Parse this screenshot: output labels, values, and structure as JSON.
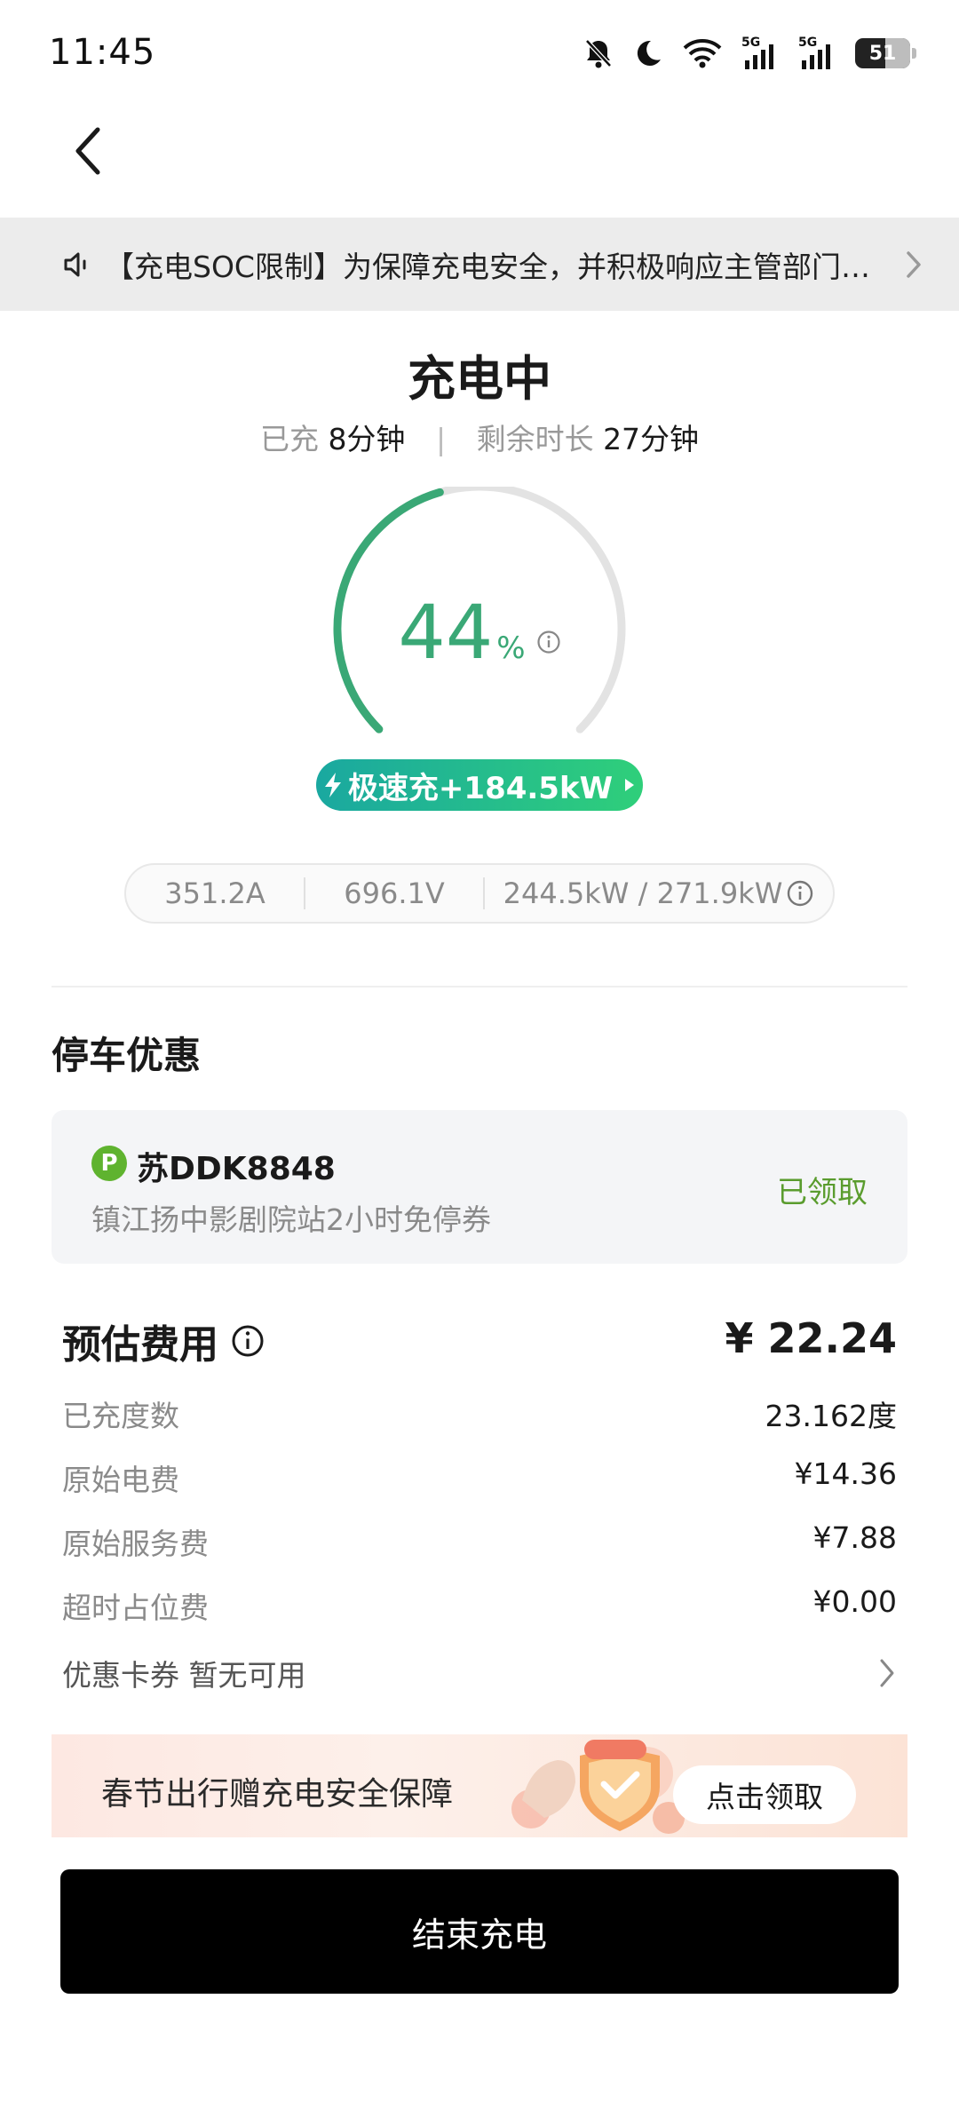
{
  "status_bar": {
    "time": "11:45",
    "network_1": "5G",
    "network_2": "5G",
    "battery_level": "51",
    "icons": [
      "bell-muted-icon",
      "moon-icon",
      "wifi-icon",
      "signal-5g-icon",
      "signal-5g-icon",
      "battery-icon"
    ]
  },
  "header": {
    "back_icon": "chevron-left-icon"
  },
  "notice": {
    "icon": "speaker-icon",
    "text": "【充电SOC限制】为保障充电安全，并积极响应主管部门要求",
    "chevron_icon": "chevron-right-icon"
  },
  "charge": {
    "title": "充电中",
    "elapsed_label": "已充",
    "elapsed_value": "8分钟",
    "separator": "|",
    "remaining_label": "剩余时长",
    "remaining_value": "27分钟",
    "percent": "44",
    "percent_unit": "%",
    "percent_fraction": 0.44,
    "fast_label": "极速充+184.5kW",
    "current": "351.2A",
    "voltage": "696.1V",
    "power": "244.5kW / 271.9kW"
  },
  "parking": {
    "heading": "停车优惠",
    "badge": "P",
    "plate": "苏DDK8848",
    "coupon": "镇江扬中影剧院站2小时免停券",
    "status": "已领取"
  },
  "fees": {
    "heading": "预估费用",
    "total": "¥ 22.24",
    "rows": [
      {
        "label": "已充度数",
        "value": "23.162度"
      },
      {
        "label": "原始电费",
        "value": "¥14.36"
      },
      {
        "label": "原始服务费",
        "value": "¥7.88"
      },
      {
        "label": "超时占位费",
        "value": "¥0.00"
      }
    ],
    "coupon_label": "优惠卡券 暂无可用"
  },
  "promo": {
    "text": "春节出行赠充电安全保障",
    "button": "点击领取"
  },
  "actions": {
    "end_label": "结束充电"
  },
  "colors": {
    "accent_green": "#3aa876",
    "gauge_track": "#e3e3e3",
    "claimed_green": "#5a9c2e",
    "end_button": "#000000"
  }
}
